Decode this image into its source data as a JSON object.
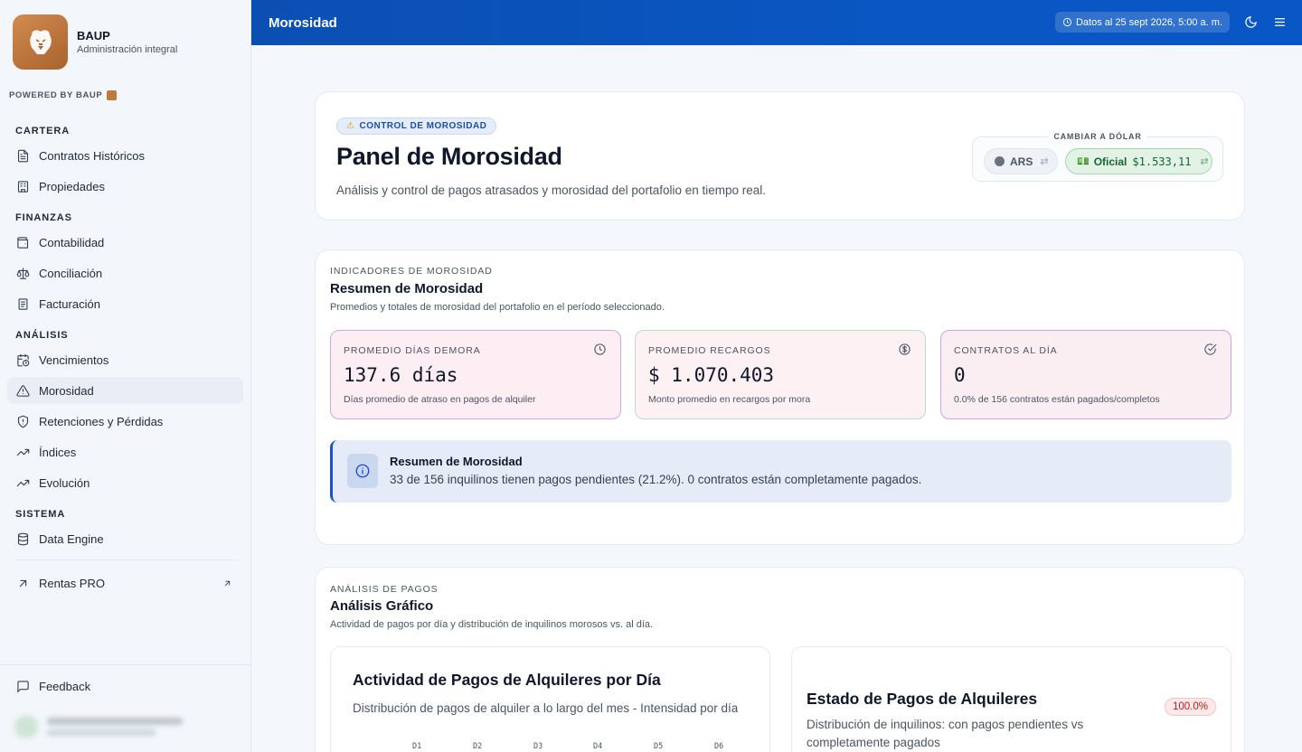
{
  "brand": {
    "name": "BAUP",
    "subtitle": "Administración integral",
    "powered_by": "POWERED BY BAUP"
  },
  "sidebar": {
    "sections": [
      {
        "title": "CARTERA",
        "items": [
          {
            "label": "Contratos Históricos",
            "icon": "file-text-icon"
          },
          {
            "label": "Propiedades",
            "icon": "building-icon"
          }
        ]
      },
      {
        "title": "FINANZAS",
        "items": [
          {
            "label": "Contabilidad",
            "icon": "wallet-icon"
          },
          {
            "label": "Conciliación",
            "icon": "scale-icon"
          },
          {
            "label": "Facturación",
            "icon": "receipt-icon"
          }
        ]
      },
      {
        "title": "ANÁLISIS",
        "items": [
          {
            "label": "Vencimientos",
            "icon": "calendar-clock-icon"
          },
          {
            "label": "Morosidad",
            "icon": "alert-triangle-icon",
            "active": true
          },
          {
            "label": "Retenciones y Pérdidas",
            "icon": "shield-icon"
          },
          {
            "label": "Índices",
            "icon": "trending-up-icon"
          },
          {
            "label": "Evolución",
            "icon": "trending-up-icon"
          }
        ]
      },
      {
        "title": "SISTEMA",
        "items": [
          {
            "label": "Data Engine",
            "icon": "database-icon"
          }
        ]
      }
    ],
    "external": {
      "label": "Rentas PRO",
      "icon": "arrow-up-right-icon"
    },
    "feedback": "Feedback"
  },
  "header": {
    "title": "Morosidad",
    "date": "Datos al 25 sept 2026, 5:00 a. m."
  },
  "hero": {
    "badge": "CONTROL DE MOROSIDAD",
    "title": "Panel de Morosidad",
    "subtitle": "Análisis y control de pagos atrasados y morosidad del portafolio en tiempo real.",
    "fx_label": "CAMBIAR A DÓLAR",
    "fx_ars": "ARS",
    "fx_official_label": "Oficial",
    "fx_official_value": "$1.533,11"
  },
  "indicators": {
    "eyebrow": "INDICADORES DE MOROSIDAD",
    "title": "Resumen de Morosidad",
    "subtitle": "Promedios y totales de morosidad del portafolio en el período seleccionado.",
    "kpis": [
      {
        "label": "PROMEDIO DÍAS DEMORA",
        "value": "137.6 días",
        "desc": "Días promedio de atraso en pagos de alquiler",
        "icon": "clock-icon"
      },
      {
        "label": "PROMEDIO RECARGOS",
        "value": "$ 1.070.403",
        "desc": "Monto promedio en recargos por mora",
        "icon": "dollar-circle-icon"
      },
      {
        "label": "CONTRATOS AL DÍA",
        "value": "0",
        "desc": "0.0% de 156 contratos están pagados/completos",
        "icon": "check-circle-icon"
      }
    ],
    "alert": {
      "title": "Resumen de Morosidad",
      "text": "33 de 156 inquilinos tienen pagos pendientes (21.2%). 0 contratos están completamente pagados."
    }
  },
  "analysis": {
    "eyebrow": "ANÁLISIS DE PAGOS",
    "title": "Análisis Gráfico",
    "subtitle": "Actividad de pagos por día y distribución de inquilinos morosos vs. al día.",
    "activity": {
      "title": "Actividad de Pagos de Alquileres por Día",
      "subtitle": "Distribución de pagos de alquiler a lo largo del mes - Intensidad por día",
      "days": [
        "D1",
        "D2",
        "D3",
        "D4",
        "D5",
        "D6"
      ]
    },
    "status": {
      "title": "Estado de Pagos de Alquileres",
      "subtitle": "Distribución de inquilinos: con pagos pendientes vs completamente pagados",
      "pct": "100.0%"
    }
  }
}
